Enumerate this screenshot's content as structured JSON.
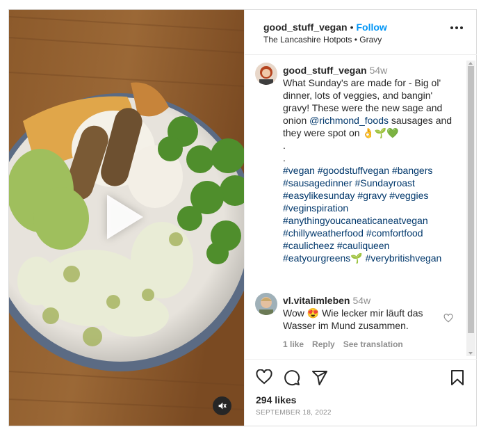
{
  "post": {
    "username": "good_stuff_vegan",
    "separator": "•",
    "follow_label": "Follow",
    "subtitle": "The Lancashire Hotpots • Gravy",
    "more_icon": "more-horizontal-icon"
  },
  "caption": {
    "username": "good_stuff_vegan",
    "time": "54w",
    "text_before": "What Sunday's are made for - Big ol' dinner, lots of veggies, and bangin' gravy! These were the new sage and onion ",
    "mention": "@richmond_foods",
    "text_after": " sausages and they were spot on 👌🌱💚\n.\n.\n",
    "hashtags": "#vegan #goodstuffvegan #bangers #sausagedinner #Sundayroast #easylikesunday #gravy #veggies #veginspiration #anythingyoucaneaticaneatvegan #chillyweatherfood #comfortfood #caulicheez #cauliqueen #eatyourgreens🌱 #verybritishvegan"
  },
  "comment": {
    "username": "vl.vitalimleben",
    "time": "54w",
    "text": "Wow 😍 Wie lecker mir läuft das Wasser im Mund zusammen.",
    "likes": "1 like",
    "reply": "Reply",
    "translate": "See translation"
  },
  "actions": {
    "likes": "294 likes",
    "date": "SEPTEMBER 18, 2022"
  },
  "colors": {
    "accent": "#0095f6",
    "hashtag": "#00376b",
    "secondary_text": "#8e8e8e"
  }
}
